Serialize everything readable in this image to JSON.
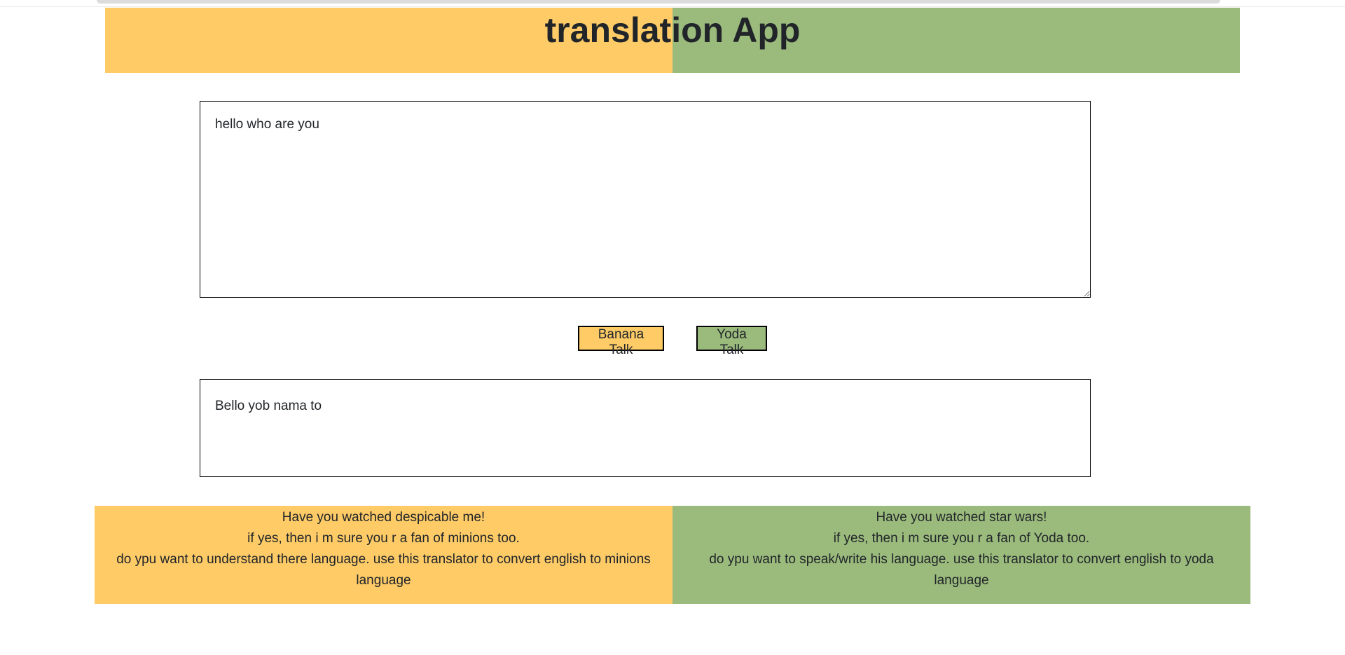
{
  "header": {
    "title": "translation App"
  },
  "input": {
    "value": "hello who are you"
  },
  "buttons": {
    "banana_label": "Banana Talk",
    "yoda_label": "Yoda Talk"
  },
  "output": {
    "text": "Bello yob nama to"
  },
  "footer": {
    "banana": {
      "line1": "Have you watched despicable me!",
      "line2": "if yes, then i m sure you r a fan of minions too.",
      "line3": "do ypu want to understand there language. use this translator to convert english to minions language"
    },
    "yoda": {
      "line1": "Have you watched star wars!",
      "line2": "if yes, then i m sure you r a fan of Yoda too.",
      "line3": "do ypu want to speak/write his language. use this translator to convert english to yoda language"
    }
  },
  "colors": {
    "banana": "#fecb67",
    "yoda": "#9bbb7d"
  }
}
